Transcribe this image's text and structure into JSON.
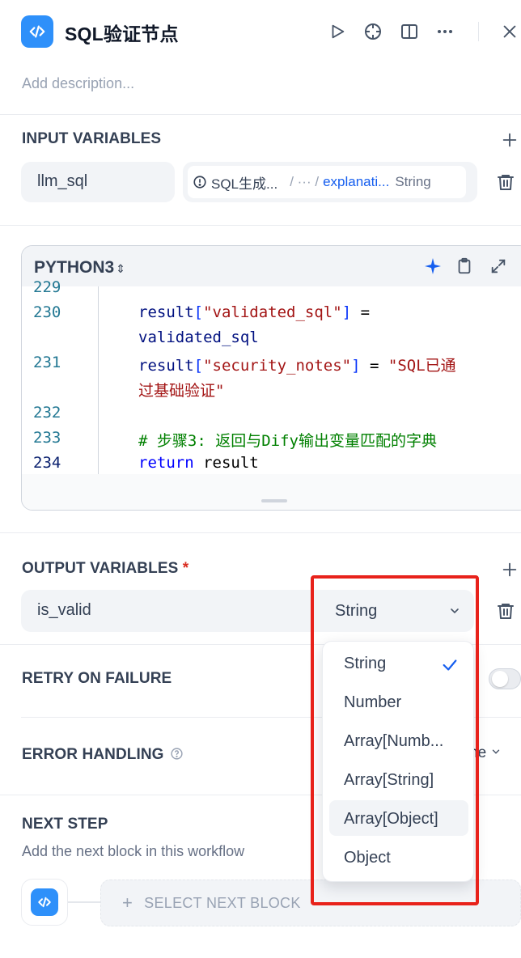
{
  "header": {
    "title": "SQL验证节点",
    "description_placeholder": "Add description..."
  },
  "input_variables": {
    "title": "INPUT VARIABLES",
    "items": [
      {
        "name": "llm_sql",
        "source_node": "SQL生成...",
        "path_ellipsis": "/ ··· /",
        "variable": "explanati...",
        "type": "String"
      }
    ]
  },
  "code_editor": {
    "language": "PYTHON3",
    "lines": [
      {
        "num": "229"
      },
      {
        "num": "230"
      },
      {
        "num": "231"
      },
      {
        "num": "232"
      },
      {
        "num": "233"
      },
      {
        "num": "234"
      }
    ],
    "code": {
      "l230_a_id": "result",
      "l230_a_br1": "[",
      "l230_a_str": "\"validated_sql\"",
      "l230_a_br2": "]",
      "l230_a_op": " =",
      "l230_b": "validated_sql",
      "l231_a_id": "result",
      "l231_a_br1": "[",
      "l231_a_str": "\"security_notes\"",
      "l231_a_br2": "]",
      "l231_a_op": " = ",
      "l231_a_str2": "\"SQL已通",
      "l231_b_str": "过基础验证\"",
      "l233_comment": "# 步骤3: 返回与Dify输出变量匹配的字典",
      "l234_kw": "return",
      "l234_rest": " result"
    }
  },
  "output_variables": {
    "title": "OUTPUT VARIABLES",
    "required_mark": "*",
    "items": [
      {
        "name": "is_valid",
        "type": "String"
      }
    ]
  },
  "type_dropdown": {
    "selected": "String",
    "options": [
      "String",
      "Number",
      "Array[Numb...",
      "Array[String]",
      "Array[Object]",
      "Object"
    ],
    "highlighted": "Array[Object]"
  },
  "retry": {
    "title": "RETRY ON FAILURE",
    "enabled": false
  },
  "error_handling": {
    "title": "ERROR HANDLING",
    "value_partial": "ne"
  },
  "next_step": {
    "title": "NEXT STEP",
    "subtitle": "Add the next block in this workflow",
    "select_label": "SELECT NEXT BLOCK"
  },
  "colors": {
    "accent": "#2e90fa",
    "annotation_box": "#e8221b"
  }
}
